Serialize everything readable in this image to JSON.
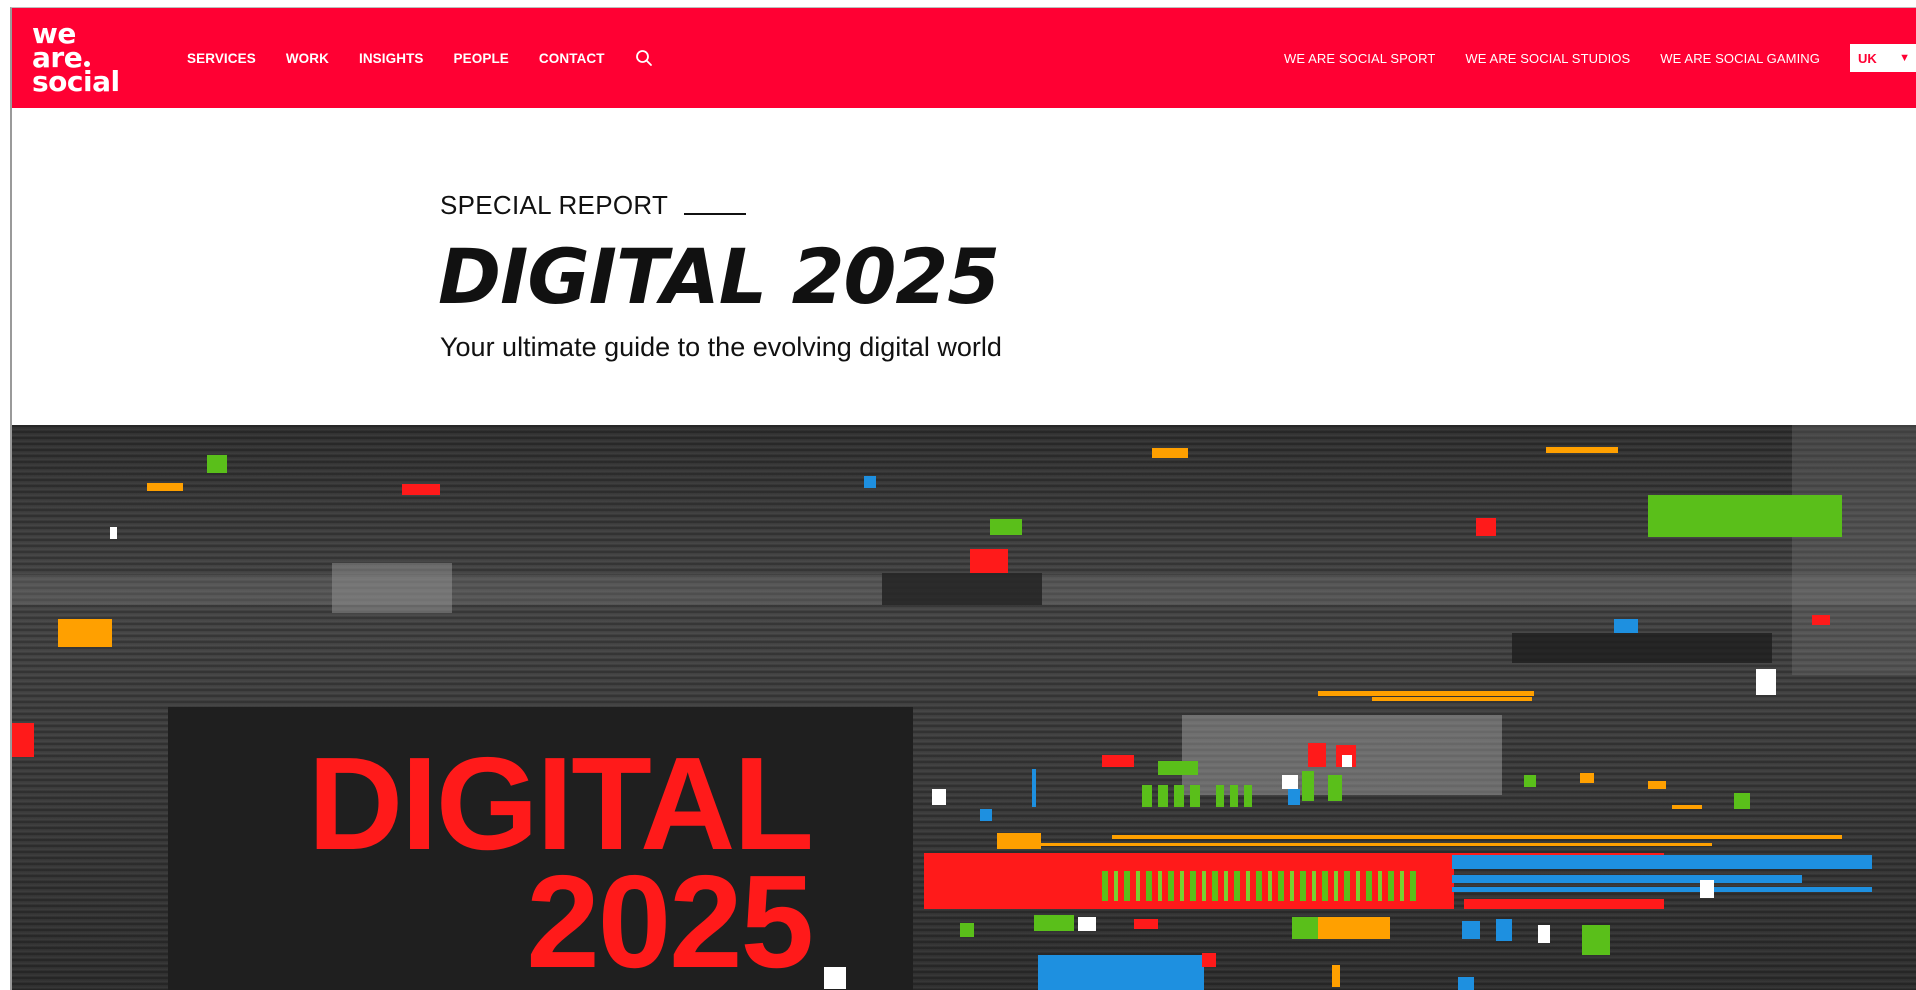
{
  "brand": {
    "logo_line1": "we",
    "logo_line2": "are",
    "logo_line3": "social",
    "color": "#ff0033"
  },
  "nav": {
    "primary": [
      "SERVICES",
      "WORK",
      "INSIGHTS",
      "PEOPLE",
      "CONTACT"
    ],
    "search_icon": "search-icon",
    "secondary": [
      "WE ARE SOCIAL SPORT",
      "WE ARE SOCIAL STUDIOS",
      "WE ARE SOCIAL GAMING"
    ],
    "language": {
      "selected": "UK",
      "caret": "▼"
    }
  },
  "hero": {
    "kicker": "SPECIAL REPORT",
    "title": "DIGITAL 2025",
    "subtitle": "Your ultimate guide to the evolving digital world",
    "image_text_line1": "DIGITAL",
    "image_text_line2": "2025",
    "image_text_color": "#ff1a1a"
  }
}
